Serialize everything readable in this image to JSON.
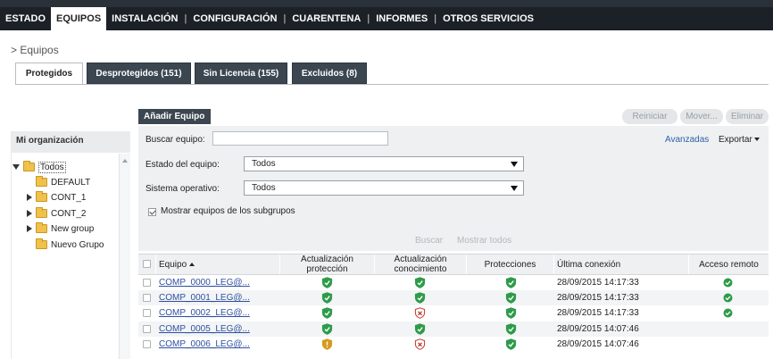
{
  "nav": {
    "items": [
      "ESTADO",
      "EQUIPOS",
      "INSTALACIÓN",
      "CONFIGURACIÓN",
      "CUARENTENA",
      "INFORMES",
      "OTROS SERVICIOS"
    ],
    "active_index": 1
  },
  "breadcrumb": "> Equipos",
  "tabs": [
    "Protegidos",
    "Desprotegidos (151)",
    "Sin Licencia (155)",
    "Excluidos (8)"
  ],
  "toolbar": {
    "add_label": "Añadir Equipo",
    "restart_label": "Reiniciar",
    "move_label": "Mover...",
    "delete_label": "Eliminar"
  },
  "sidebar": {
    "title": "Mi organización",
    "tree": [
      "Todos",
      "DEFAULT",
      "CONT_1",
      "CONT_2",
      "New group",
      "Nuevo Grupo"
    ]
  },
  "filters": {
    "search_label": "Buscar equipo:",
    "search_value": "",
    "advanced_label": "Avanzadas",
    "export_label": "Exportar",
    "state_label": "Estado del equipo:",
    "state_value": "Todos",
    "os_label": "Sistema operativo:",
    "os_value": "Todos",
    "subgroups_label": "Mostrar equipos de los subgrupos",
    "subgroups_checked": true,
    "search_button": "Buscar",
    "show_all_button": "Mostrar todos"
  },
  "table": {
    "columns": [
      "Equipo",
      "Actualización protección",
      "Actualización conocimiento",
      "Protecciones",
      "Última conexión",
      "Acceso remoto"
    ],
    "rows": [
      {
        "equipo": "COMP_0000_LEG@...",
        "act_prot": "ok",
        "act_con": "ok",
        "protecciones": "ok",
        "ultima": "28/09/2015 14:17:33",
        "remoto": true
      },
      {
        "equipo": "COMP_0001_LEG@...",
        "act_prot": "ok",
        "act_con": "ok",
        "protecciones": "ok",
        "ultima": "28/09/2015 14:17:33",
        "remoto": true
      },
      {
        "equipo": "COMP_0002_LEG@...",
        "act_prot": "ok",
        "act_con": "error",
        "protecciones": "ok",
        "ultima": "28/09/2015 14:17:33",
        "remoto": true
      },
      {
        "equipo": "COMP_0005_LEG@...",
        "act_prot": "ok",
        "act_con": "ok",
        "protecciones": "ok",
        "ultima": "28/09/2015 14:07:46",
        "remoto": false
      },
      {
        "equipo": "COMP_0006_LEG@...",
        "act_prot": "warning",
        "act_con": "error",
        "protecciones": "ok",
        "ultima": "28/09/2015 14:07:46",
        "remoto": false
      }
    ]
  },
  "colors": {
    "nav_bg": "#1c2127",
    "tab_dark": "#3b4650",
    "link": "#2f4fa0",
    "ok_green": "#2e9b4a",
    "error_red": "#c0392b",
    "warning_amber": "#d79a1c"
  }
}
